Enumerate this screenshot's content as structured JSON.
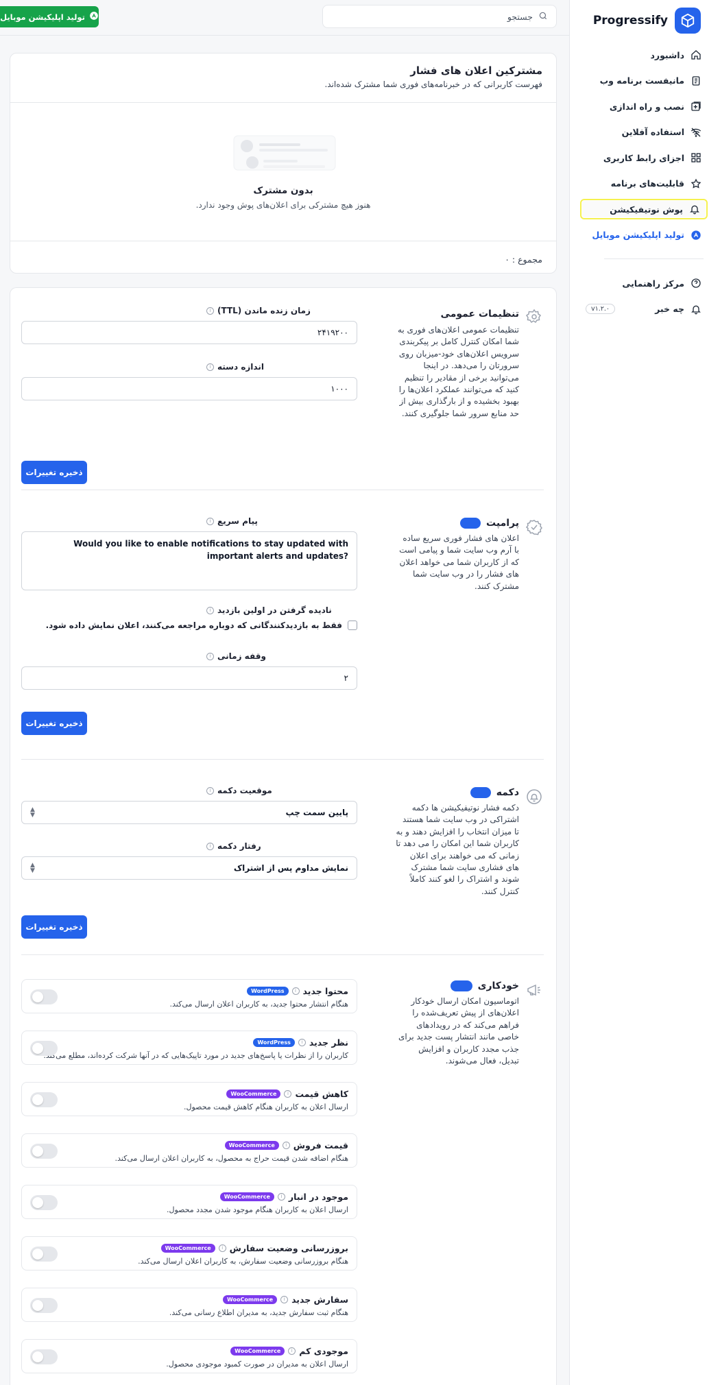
{
  "sidebar": {
    "brand": "Progressify",
    "items": [
      {
        "label": "داشبورد",
        "icon": "home-icon"
      },
      {
        "label": "مانیفست برنامه وب",
        "icon": "document-icon"
      },
      {
        "label": "نصب و راه اندازی",
        "icon": "install-icon"
      },
      {
        "label": "استفاده آفلاین",
        "icon": "wifi-off-icon"
      },
      {
        "label": "اجزای رابط کاربری",
        "icon": "grid-icon"
      },
      {
        "label": "قابلیت‌های برنامه",
        "icon": "star-icon"
      },
      {
        "label": "پوش نوتیفیکیشن",
        "icon": "bell-icon"
      },
      {
        "label": "تولید اپلیکیشن موبایل",
        "icon": "app-icon"
      }
    ],
    "help": {
      "label": "مرکز راهنمایی",
      "icon": "help-icon"
    },
    "news": {
      "label": "چه خبر",
      "icon": "bell-icon",
      "version": "v۱.۲.۰"
    }
  },
  "topbar": {
    "search_placeholder": "جستجو",
    "generate_app_label": "تولید اپلیکیشن موبایل"
  },
  "subscribers": {
    "title": "مشترکین اعلان های فشار",
    "description": "فهرست کاربرانی که در خبرنامه‌های فوری شما مشترک شده‌اند.",
    "empty_title": "بدون مشترک",
    "empty_desc": "هنوز هیچ مشترکی برای اعلان‌های پوش وجود ندارد.",
    "total": "مجموع : ۰"
  },
  "general": {
    "title": "تنظیمات عمومی",
    "description": "تنظیمات عمومی اعلان‌های فوری به شما امکان کنترل کامل بر پیکربندی سرویس اعلان‌های خود-میزبان روی سرورتان را می‌دهد. در اینجا می‌توانید برخی از مقادیر را تنظیم کنید که می‌توانند عملکرد اعلان‌ها را بهبود بخشیده و از بارگذاری بیش از حد منابع سرور شما جلوگیری کنند.",
    "ttl_label": "زمان زنده ماندن (TTL)",
    "ttl_value": "۲۴۱۹۲۰۰",
    "batch_label": "اندازه دسته",
    "batch_value": "۱۰۰۰",
    "save_label": "ذخیره تغییرات"
  },
  "prompt": {
    "title": "پرامپت",
    "description": "اعلان های فشار فوری سریع ساده با آرم وب سایت شما و پیامی است که از کاربران شما می خواهد اعلان های فشار را در وب سایت شما مشترک کنند.",
    "message_label": "پیام سریع",
    "message_value": "Would you like to enable notifications to stay updated with important alerts and updates?",
    "skip_label": "نادیده گرفتن در اولین بازدید",
    "skip_checkbox": "فقط به بازدیدکنندگانی که دوباره مراجعه می‌کنند، اعلان نمایش داده شود.",
    "delay_label": "وقفه زمانی",
    "delay_value": "۲",
    "save_label": "ذخیره تغییرات"
  },
  "button": {
    "title": "دکمه",
    "description": "دکمه فشار نوتیفیکیشن ها دکمه اشتراکی در وب سایت شما هستند تا میزان انتخاب را افزایش دهند و به کاربران شما این امکان را می دهد تا زمانی که می خواهند برای اعلان های فشاری سایت شما مشترک شوند و اشتراک را لغو کنند کاملاً کنترل کنند.",
    "position_label": "موقعیت دکمه",
    "position_value": "پایین سمت چپ",
    "behavior_label": "رفتار دکمه",
    "behavior_value": "نمایش مداوم پس از اشتراک",
    "save_label": "ذخیره تغییرات"
  },
  "automation": {
    "title": "خودکاری",
    "description": "اتوماسیون امکان ارسال خودکار اعلان‌های از پیش تعریف‌شده را فراهم می‌کند که در رویدادهای خاصی مانند انتشار پست جدید برای جذب مجدد کاربران و افزایش تبدیل، فعال می‌شوند.",
    "items": [
      {
        "title": "محتوا جدید",
        "badge": "WordPress",
        "desc": "هنگام انتشار محتوا جدید، به کاربران اعلان ارسال می‌کند."
      },
      {
        "title": "نظر جدید",
        "badge": "WordPress",
        "desc": "کاربران را از نظرات یا پاسخ‌های جدید در مورد تاپیک‌هایی که در آنها شرکت کرده‌اند، مطلع می‌کند."
      },
      {
        "title": "کاهش قیمت",
        "badge": "WooCommerce",
        "desc": "ارسال اعلان به کاربران هنگام کاهش قیمت محصول."
      },
      {
        "title": "قیمت فروش",
        "badge": "WooCommerce",
        "desc": "هنگام اضافه شدن قیمت حراج به محصول، به کاربران اعلان ارسال می‌کند."
      },
      {
        "title": "موجود در انبار",
        "badge": "WooCommerce",
        "desc": "ارسال اعلان به کاربران هنگام موجود شدن مجدد محصول."
      },
      {
        "title": "بروزرسانی وضعیت سفارش",
        "badge": "WooCommerce",
        "desc": "هنگام بروزرسانی وضعیت سفارش، به کاربران اعلان ارسال می‌کند."
      },
      {
        "title": "سفارش جدید",
        "badge": "WooCommerce",
        "desc": "هنگام ثبت سفارش جدید، به مدیران اطلاع رسانی می‌کند."
      },
      {
        "title": "موجودی کم",
        "badge": "WooCommerce",
        "desc": "ارسال اعلان به مدیران در صورت کمبود موجودی محصول."
      }
    ]
  }
}
